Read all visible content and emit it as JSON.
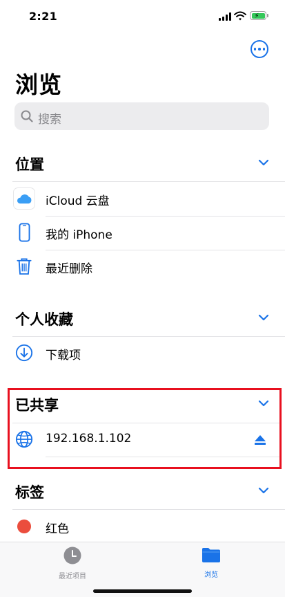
{
  "status": {
    "time": "2:21"
  },
  "page": {
    "title": "浏览"
  },
  "search": {
    "placeholder": "搜索"
  },
  "sections": {
    "locations": {
      "title": "位置",
      "items": [
        {
          "label": "iCloud 云盘",
          "icon": "icloud-icon"
        },
        {
          "label": "我的 iPhone",
          "icon": "iphone-icon"
        },
        {
          "label": "最近删除",
          "icon": "trash-icon"
        }
      ]
    },
    "favorites": {
      "title": "个人收藏",
      "items": [
        {
          "label": "下载项",
          "icon": "download-icon"
        }
      ]
    },
    "shared": {
      "title": "已共享",
      "items": [
        {
          "label": "192.168.1.102",
          "icon": "globe-icon",
          "action_icon": "eject-icon"
        }
      ]
    },
    "tags": {
      "title": "标签",
      "items": [
        {
          "label": "红色",
          "color": "#eb4d3d"
        }
      ]
    }
  },
  "tab_bar": {
    "tabs": [
      {
        "label": "最近项目",
        "icon": "clock-icon",
        "active": false
      },
      {
        "label": "浏览",
        "icon": "folder-icon",
        "active": true
      }
    ]
  },
  "colors": {
    "accent": "#1a73e8",
    "highlight": "#e8101f",
    "battery": "#34c759"
  }
}
